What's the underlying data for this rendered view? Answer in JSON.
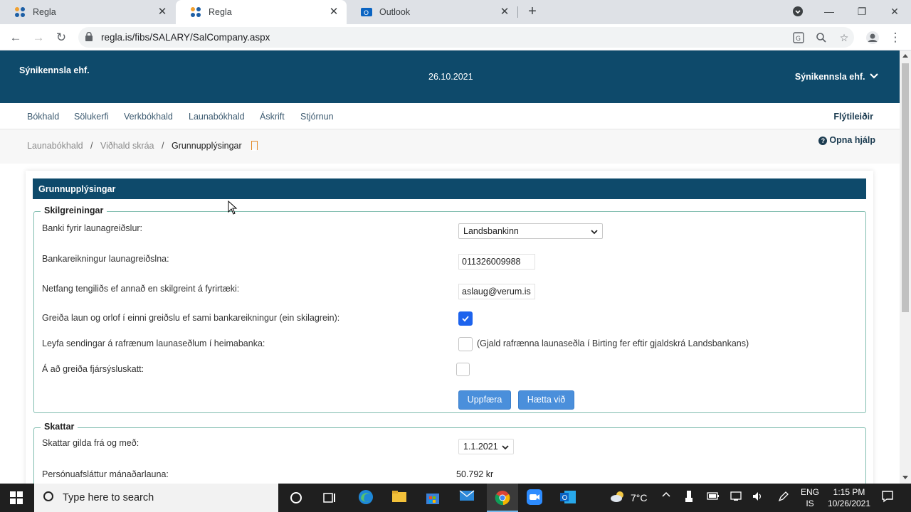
{
  "browser": {
    "tabs": [
      {
        "title": "Regla",
        "active": false
      },
      {
        "title": "Regla",
        "active": true
      },
      {
        "title": "Outlook",
        "active": false
      }
    ],
    "url": "regla.is/fibs/SALARY/SalCompany.aspx"
  },
  "header": {
    "company": "Sýnikennsla ehf.",
    "date": "26.10.2021",
    "user_menu": "Sýnikennsla ehf."
  },
  "nav": {
    "items": [
      "Bókhald",
      "Sölukerfi",
      "Verkbókhald",
      "Launabókhald",
      "Áskrift",
      "Stjórnun"
    ],
    "quick_links": "Flýtileiðir"
  },
  "breadcrumb": {
    "items": [
      "Launabókhald",
      "Viðhald skráa",
      "Grunnupplýsingar"
    ],
    "separator": "/"
  },
  "help": "Opna hjálp",
  "card": {
    "title": "Grunnupplýsingar",
    "skilgreiningar": {
      "legend": "Skilgreiningar",
      "bank_label": "Banki fyrir launagreiðslur:",
      "bank_value": "Landsbankinn",
      "account_label": "Bankareikningur launagreiðslna:",
      "account_value": "011326009988",
      "email_label": "Netfang tengiliðs ef annað en skilgreint á fyrirtæki:",
      "email_value": "aslaug@verum.is",
      "single_payment_label": "Greiða laun og orlof í einni greiðslu ef sami bankareikningur (ein skilagrein):",
      "single_payment_checked": true,
      "e_payslip_label": "Leyfa sendingar á rafrænum launaseðlum í heimabanka:",
      "e_payslip_checked": false,
      "e_payslip_note": "(Gjald rafrænna launaseðla í Birting fer eftir gjaldskrá Landsbankans)",
      "tax_label": "Á að greiða fjársýsluskatt:",
      "tax_checked": false,
      "update_button": "Uppfæra",
      "cancel_button": "Hætta við"
    },
    "skattar": {
      "legend": "Skattar",
      "valid_from_label": "Skattar gilda frá og með:",
      "valid_from_value": "1.1.2021",
      "personal_allowance_label": "Persónuafsláttur mánaðarlauna:",
      "personal_allowance_value": "50.792 kr"
    }
  },
  "taskbar": {
    "search_placeholder": "Type here to search",
    "weather": "7°C",
    "lang_top": "ENG",
    "lang_bottom": "IS",
    "time": "1:15 PM",
    "date": "10/26/2021"
  }
}
